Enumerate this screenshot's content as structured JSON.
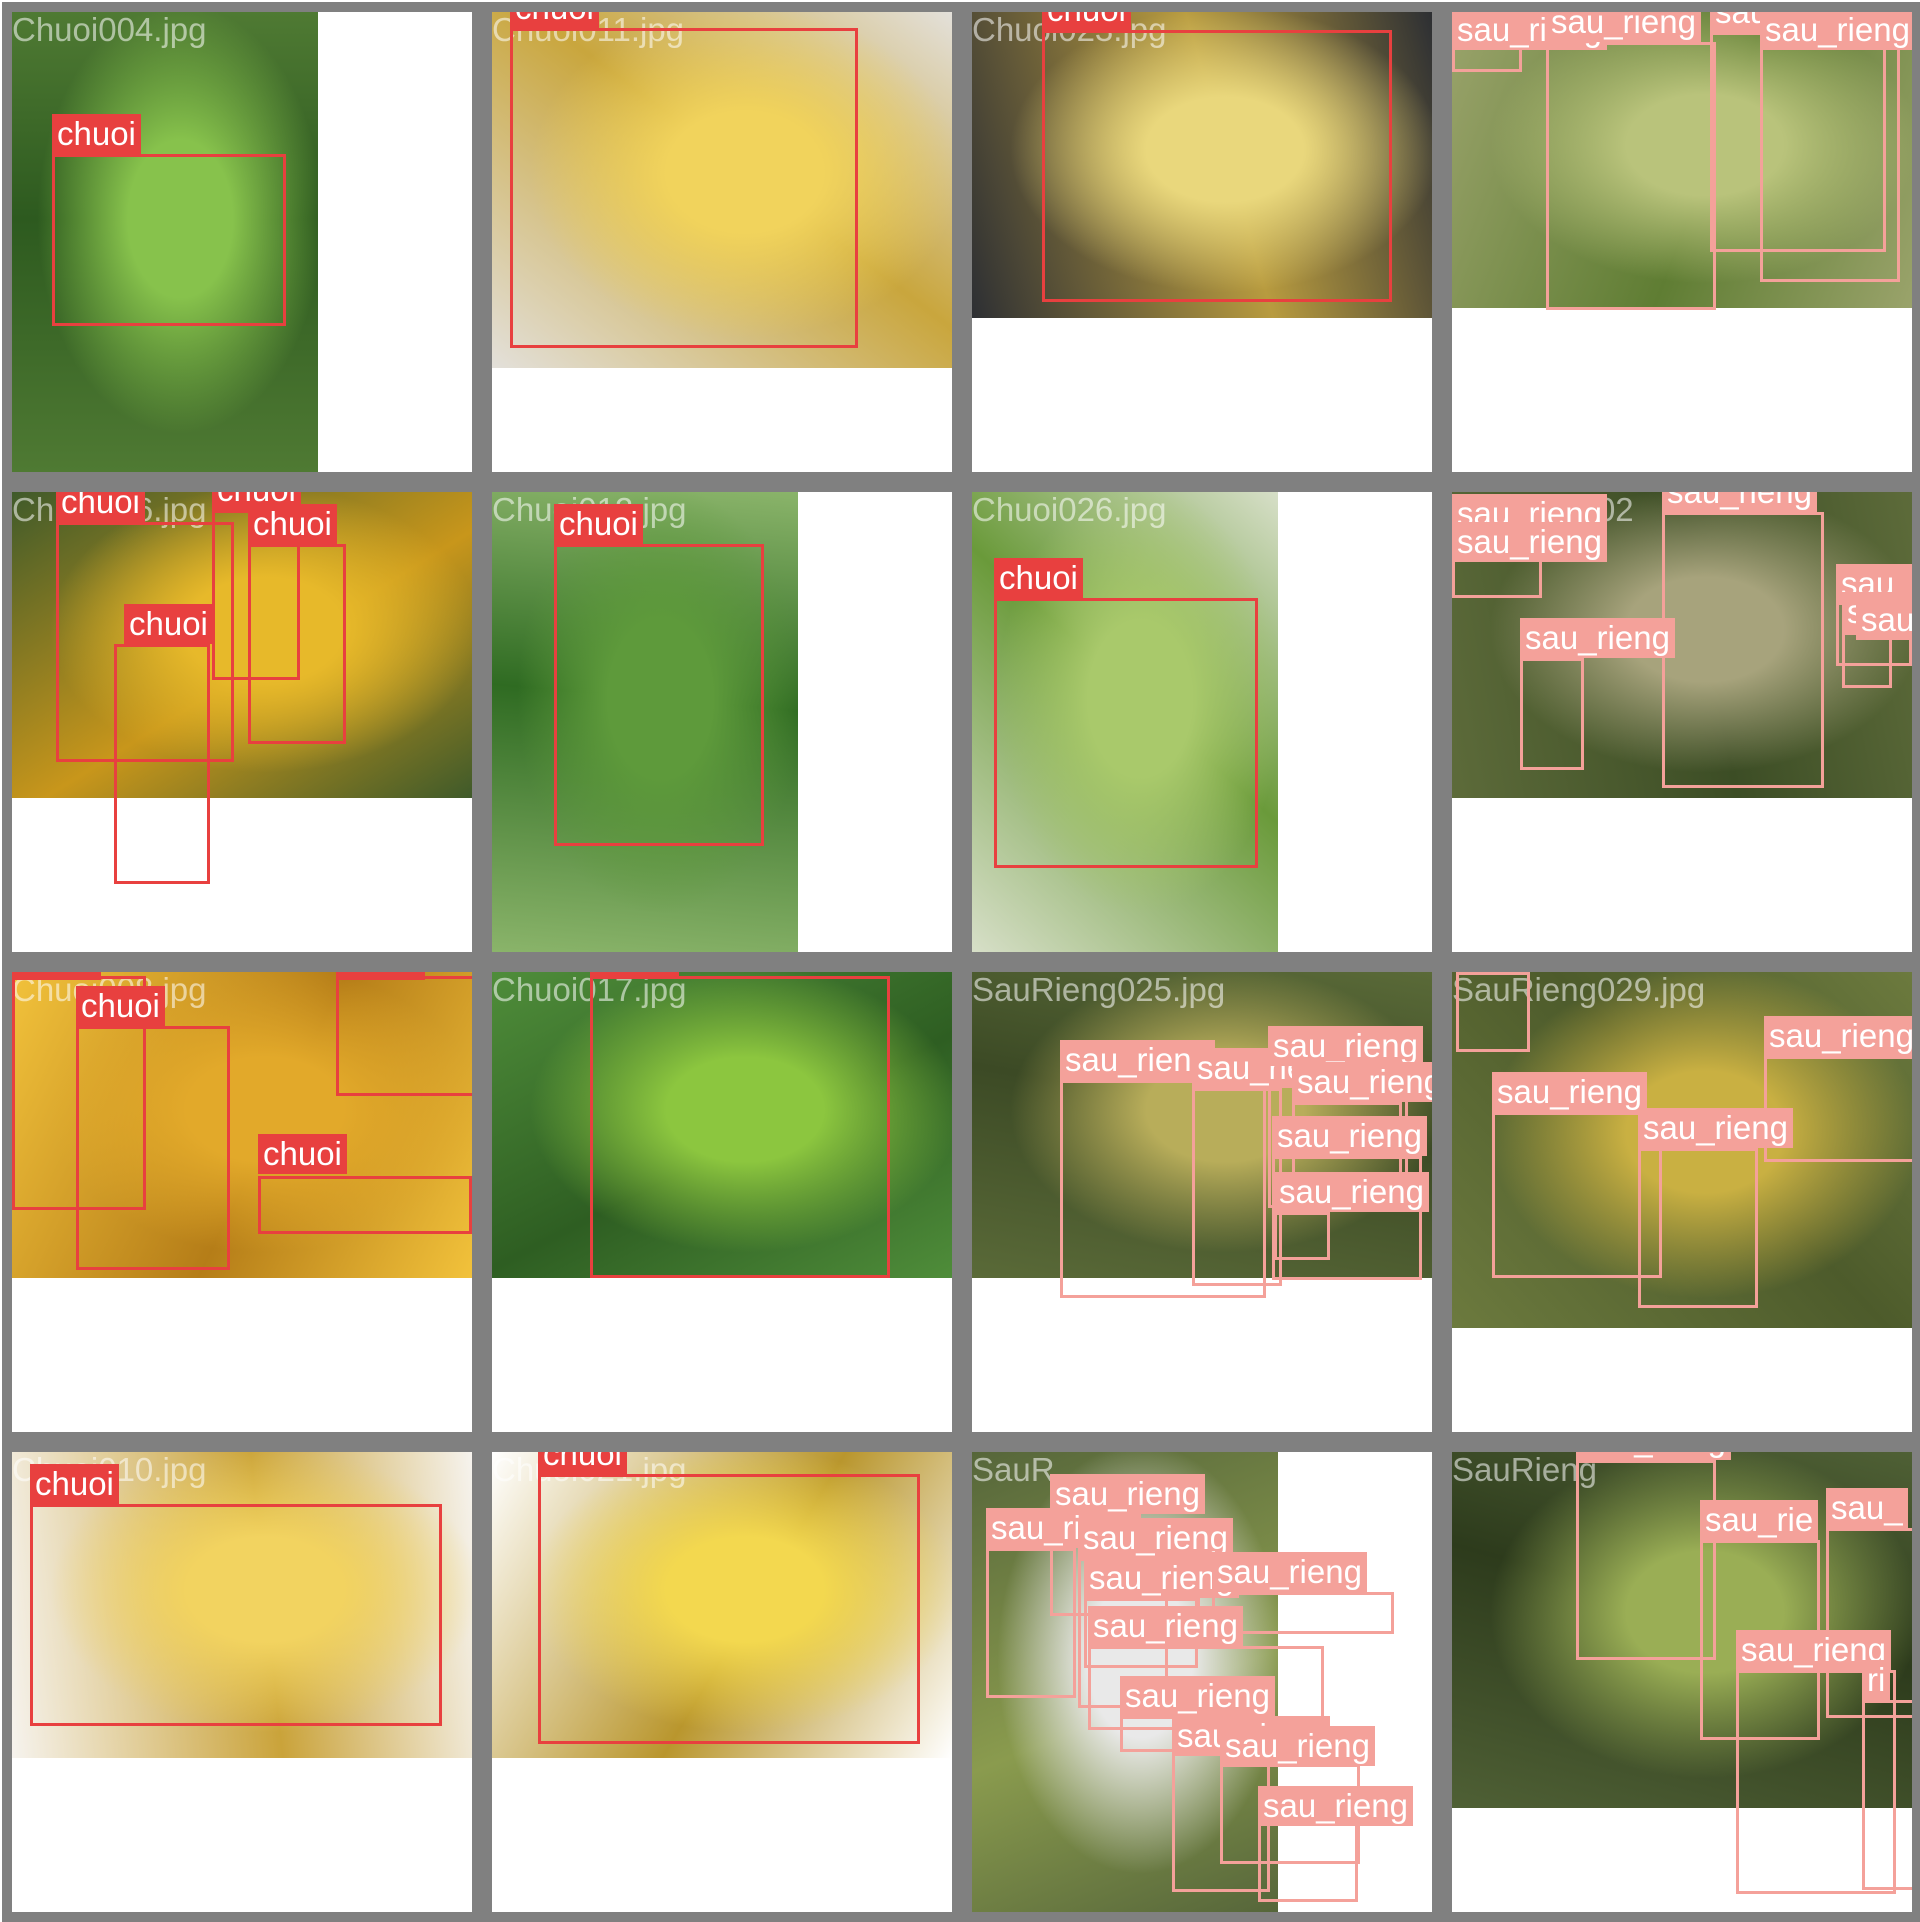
{
  "colors": {
    "tile_border": "#808080",
    "chuoi": "#e8403f",
    "sau_rieng": "#f4a19a"
  },
  "tiles": [
    {
      "filename": "Chuoi004.jpg",
      "photo": {
        "colors": [
          "#4f7a33",
          "#87c24c",
          "#2d5a1f"
        ]
      },
      "detections": [
        {
          "cls": "chuoi",
          "label": "chuoi"
        }
      ]
    },
    {
      "filename": "Chuoi011.jpg",
      "photo": {
        "colors": [
          "#e3e0da",
          "#f1d35c",
          "#c9a63d"
        ]
      },
      "detections": [
        {
          "cls": "chuoi",
          "label": "chuoi"
        }
      ]
    },
    {
      "filename": "Chuoi023.jpg",
      "photo": {
        "colors": [
          "#2d2f33",
          "#e9d77c",
          "#b89b3f"
        ]
      },
      "detections": [
        {
          "cls": "chuoi",
          "label": "chuoi"
        }
      ]
    },
    {
      "filename": "",
      "photo": {
        "colors": [
          "#9aa36b",
          "#b9c37b",
          "#5f7d33"
        ]
      },
      "detections": [
        {
          "cls": "sau_rieng",
          "label": "sau_rieng"
        },
        {
          "cls": "sau_rieng",
          "label": "sau_rieng"
        },
        {
          "cls": "sau_rieng",
          "label": "sau_rieng"
        },
        {
          "cls": "sau_rieng",
          "label": "sau_rieng"
        }
      ]
    },
    {
      "filename": "Chuoi026.jpg",
      "photo": {
        "colors": [
          "#3f5a2a",
          "#e7b92a",
          "#c8961b"
        ]
      },
      "detections": [
        {
          "cls": "chuoi",
          "label": "chuoi"
        },
        {
          "cls": "chuoi",
          "label": "chuoi"
        },
        {
          "cls": "chuoi",
          "label": "chuoi"
        },
        {
          "cls": "chuoi",
          "label": "chuoi"
        }
      ]
    },
    {
      "filename": "Chuoi012.jpg",
      "photo": {
        "colors": [
          "#8ab46a",
          "#5e9a3b",
          "#2f6b22"
        ]
      },
      "detections": [
        {
          "cls": "chuoi",
          "label": "chuoi"
        }
      ]
    },
    {
      "filename": "Chuoi026.jpg",
      "photo": {
        "colors": [
          "#d7dfc8",
          "#a9c96b",
          "#6a9a3a"
        ]
      },
      "detections": [
        {
          "cls": "chuoi",
          "label": "chuoi"
        }
      ]
    },
    {
      "filename": "SauRieng02",
      "photo": {
        "colors": [
          "#5d6b3a",
          "#a7a37c",
          "#3c4d25"
        ]
      },
      "detections": [
        {
          "cls": "sau_rieng",
          "label": "sau_rieng"
        },
        {
          "cls": "sau_rieng",
          "label": "sau_rieng"
        },
        {
          "cls": "sau_rieng",
          "label": "sau_rieng"
        },
        {
          "cls": "sau_rieng",
          "label": "sau_rieng"
        },
        {
          "cls": "sau_rieng",
          "label": "sau_rieng"
        },
        {
          "cls": "sau_rieng",
          "label": "sau_rieng"
        },
        {
          "cls": "sau_rieng",
          "label": "sau_rieng"
        }
      ]
    },
    {
      "filename": "Chuoi008.jpg",
      "photo": {
        "colors": [
          "#f2c23b",
          "#e2a92a",
          "#b57d18"
        ]
      },
      "detections": [
        {
          "cls": "chuoi",
          "label": "chuoi"
        },
        {
          "cls": "chuoi",
          "label": "chuoi"
        },
        {
          "cls": "chuoi",
          "label": "chuoi"
        },
        {
          "cls": "chuoi",
          "label": "chuoi"
        }
      ]
    },
    {
      "filename": "Chuoi017.jpg",
      "photo": {
        "colors": [
          "#4f8d3a",
          "#8cc63f",
          "#2e5e22"
        ]
      },
      "detections": [
        {
          "cls": "chuoi",
          "label": "chuoi"
        }
      ]
    },
    {
      "filename": "SauRieng025.jpg",
      "photo": {
        "colors": [
          "#5a6a38",
          "#b8ad5a",
          "#3c4a25"
        ]
      },
      "detections": [
        {
          "cls": "sau_rieng",
          "label": "sau_rieng"
        },
        {
          "cls": "sau_rieng",
          "label": "sau_rieng"
        },
        {
          "cls": "sau_rieng",
          "label": "sau_rieng"
        },
        {
          "cls": "sau_rieng",
          "label": "sau_rieng"
        },
        {
          "cls": "sau_rieng",
          "label": "sau_rieng"
        },
        {
          "cls": "sau_rieng",
          "label": "sau_rieng"
        }
      ]
    },
    {
      "filename": "SauRieng029.jpg",
      "photo": {
        "colors": [
          "#6c7a3e",
          "#c9b042",
          "#4d5b2b"
        ]
      },
      "detections": [
        {
          "cls": "sau_rieng",
          "label": "sau_rieng"
        },
        {
          "cls": "sau_rieng",
          "label": "sau_rieng"
        },
        {
          "cls": "sau_rieng",
          "label": "sau_rieng"
        },
        {
          "cls": "sau_rieng",
          "label": "sau_rieng"
        }
      ]
    },
    {
      "filename": "Chuoi010.jpg",
      "photo": {
        "colors": [
          "#f6f3ee",
          "#f2d360",
          "#caa33a"
        ]
      },
      "detections": [
        {
          "cls": "chuoi",
          "label": "chuoi"
        }
      ]
    },
    {
      "filename": "Chuoi021.jpg",
      "photo": {
        "colors": [
          "#ffffff",
          "#f3d84f",
          "#b9962d"
        ]
      },
      "detections": [
        {
          "cls": "chuoi",
          "label": "chuoi"
        }
      ]
    },
    {
      "filename": "SauR",
      "photo": {
        "colors": [
          "#56663a",
          "#e9e9e9",
          "#8a9b4e"
        ]
      },
      "detections": [
        {
          "cls": "sau_rieng",
          "label": "sau_rieng"
        },
        {
          "cls": "sau_rieng",
          "label": "sau_rieng"
        },
        {
          "cls": "sau_rieng",
          "label": "sau_rieng"
        },
        {
          "cls": "sau_rieng",
          "label": "sau_rieng"
        },
        {
          "cls": "sau_rieng",
          "label": "sau_rieng"
        },
        {
          "cls": "sau_rieng",
          "label": "sau_rieng"
        },
        {
          "cls": "sau_rieng",
          "label": "sau_rieng"
        },
        {
          "cls": "sau_rieng",
          "label": "sau_rieng"
        },
        {
          "cls": "sau_rieng",
          "label": "sau_rieng"
        },
        {
          "cls": "sau_rieng",
          "label": "sau_rieng"
        }
      ]
    },
    {
      "filename": "SauRieng",
      "photo": {
        "colors": [
          "#4f6035",
          "#9aae55",
          "#2d3b1c"
        ]
      },
      "detections": [
        {
          "cls": "sau_rieng",
          "label": "sau_rieng"
        },
        {
          "cls": "sau_rieng",
          "label": "sau_rie"
        },
        {
          "cls": "sau_rieng",
          "label": "sau_"
        },
        {
          "cls": "sau_rieng",
          "label": "sau_rieng"
        },
        {
          "cls": "sau_rieng",
          "label": "ri"
        }
      ]
    }
  ]
}
